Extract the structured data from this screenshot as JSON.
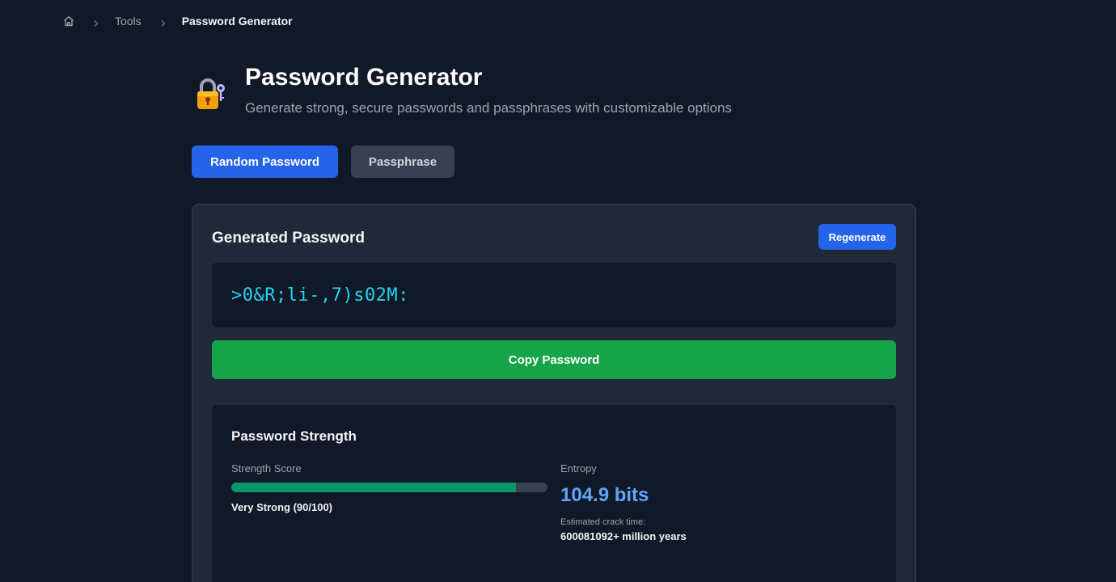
{
  "breadcrumb": {
    "home_icon": "home-icon",
    "separator_icon": "chevron-right-icon",
    "items": [
      "Tools",
      "Password Generator"
    ]
  },
  "header": {
    "icon": "locked-with-key-icon",
    "title": "Password Generator",
    "subtitle": "Generate strong, secure passwords and passphrases with customizable options"
  },
  "tabs": [
    {
      "label": "Random Password",
      "active": true
    },
    {
      "label": "Passphrase",
      "active": false
    }
  ],
  "generator": {
    "title": "Generated Password",
    "regenerate_label": "Regenerate",
    "password": ">0&R;li-,7)s02M:",
    "copy_label": "Copy Password"
  },
  "strength": {
    "title": "Password Strength",
    "score_label": "Strength Score",
    "score_percent": 90,
    "score_text": "Very Strong (90/100)",
    "entropy_label": "Entropy",
    "entropy_value": "104.9 bits",
    "crack_time_label": "Estimated crack time:",
    "crack_time_value": "600081092+ million years"
  },
  "colors": {
    "background": "#111827",
    "card": "#1f2937",
    "primary": "#2563eb",
    "success": "#16a34a",
    "meter_fill": "#059669",
    "password_text": "#22d3ee",
    "entropy_text": "#60a5fa"
  }
}
